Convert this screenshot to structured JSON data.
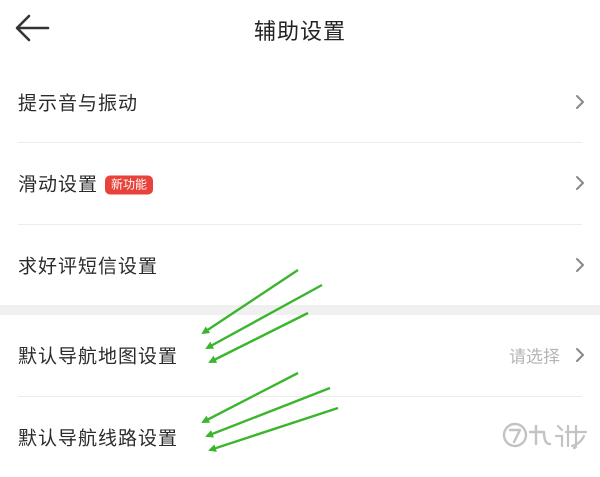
{
  "header": {
    "title": "辅助设置",
    "back_icon": "arrow-left-icon"
  },
  "settings": {
    "items": [
      {
        "label": "提示音与振动",
        "badge": "",
        "value": ""
      },
      {
        "label": "滑动设置",
        "badge": "新功能",
        "value": ""
      },
      {
        "label": "求好评短信设置",
        "badge": "",
        "value": ""
      },
      {
        "label": "默认导航地图设置",
        "badge": "",
        "value": "请选择"
      },
      {
        "label": "默认导航线路设置",
        "badge": "",
        "value": ""
      }
    ]
  },
  "colors": {
    "badge": "#e8423a",
    "annotation_arrow": "#3cb52e",
    "placeholder": "#b5b5b5",
    "section_gap": "#f0f0f0"
  },
  "icons": {
    "chevron": "chevron-right-icon",
    "annotation": "green-arrow-icon",
    "watermark_logo": "jiuyou-logo"
  }
}
